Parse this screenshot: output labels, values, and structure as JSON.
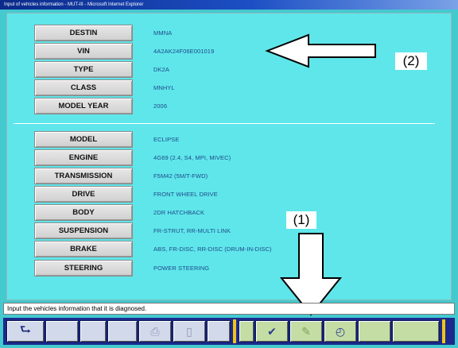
{
  "window": {
    "title": "Input of vehicles information - MUT-III - Microsoft Internet Explorer"
  },
  "vehicle_fields_top": [
    {
      "label": "DESTIN",
      "value": "MMNA"
    },
    {
      "label": "VIN",
      "value": "4A2AK24F06E001019"
    },
    {
      "label": "TYPE",
      "value": "DK2A"
    },
    {
      "label": "CLASS",
      "value": "MNHYL"
    },
    {
      "label": "MODEL YEAR",
      "value": "2006"
    }
  ],
  "vehicle_fields_bottom": [
    {
      "label": "MODEL",
      "value": "ECLIPSE"
    },
    {
      "label": "ENGINE",
      "value": "4G69 (2.4, S4, MPI, MIVEC)"
    },
    {
      "label": "TRANSMISSION",
      "value": "F5M42 (5M/T-FWD)"
    },
    {
      "label": "DRIVE",
      "value": "FRONT WHEEL DRIVE"
    },
    {
      "label": "BODY",
      "value": "2DR HATCHBACK"
    },
    {
      "label": "SUSPENSION",
      "value": "FR-STRUT, RR-MULTI LINK"
    },
    {
      "label": "BRAKE",
      "value": "ABS, FR-DISC, RR-DISC (DRUM-IN-DISC)"
    },
    {
      "label": "STEERING",
      "value": "POWER STEERING"
    }
  ],
  "annotations": {
    "callout_2": "(2)",
    "callout_1": "(1)"
  },
  "status": {
    "message": "Input the vehicles information that it is diagnosed."
  },
  "toolbar": {
    "left_buttons": [
      "back-icon",
      "empty",
      "empty",
      "empty",
      "print-icon",
      "delete-icon"
    ],
    "right_buttons": [
      "empty",
      "check-icon",
      "pen-icon",
      "gauge-icon",
      "empty",
      "empty"
    ]
  },
  "colors": {
    "window_bg": "#44c9cf",
    "panel_bg": "#5fe6ea",
    "toolbar_bg": "#1a2a8c",
    "toolbar_separator": "#f0c419",
    "value_text": "#1d4a8a"
  }
}
